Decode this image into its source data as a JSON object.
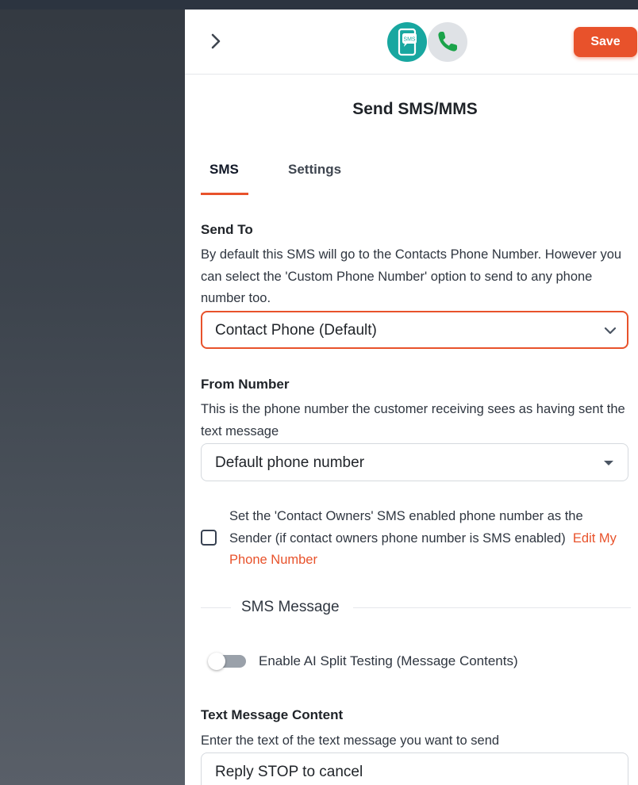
{
  "header": {
    "save_label": "Save",
    "icons": [
      "chevron-right-icon",
      "sms-icon",
      "phone-icon"
    ],
    "sms_icon_text": "SMS"
  },
  "title": "Send SMS/MMS",
  "tabs": [
    {
      "label": "SMS",
      "active": true
    },
    {
      "label": "Settings",
      "active": false
    }
  ],
  "send_to": {
    "label": "Send To",
    "description": "By default this SMS will go to the Contacts Phone Number. However you can select the 'Custom Phone Number' option to send to any phone number too.",
    "value": "Contact Phone (Default)"
  },
  "from_number": {
    "label": "From Number",
    "description": "This is the phone number the customer receiving sees as having sent the text message",
    "value": "Default phone number"
  },
  "owner_checkbox": {
    "checked": false,
    "text": "Set the 'Contact Owners' SMS enabled phone number as the Sender (if contact owners phone number is SMS enabled)",
    "link": "Edit My Phone Number"
  },
  "sms_message": {
    "section_title": "SMS Message",
    "ai_toggle_label": "Enable AI Split Testing (Message Contents)",
    "ai_toggle_on": false
  },
  "text_content": {
    "label": "Text Message Content",
    "description": "Enter the text of the text message you want to send",
    "value": "Reply STOP to cancel"
  },
  "colors": {
    "accent": "#e8522b",
    "sms_icon_bg": "#18a7a0",
    "phone_icon_bg": "#dfe2e6",
    "phone_glyph": "#1ba34a"
  }
}
